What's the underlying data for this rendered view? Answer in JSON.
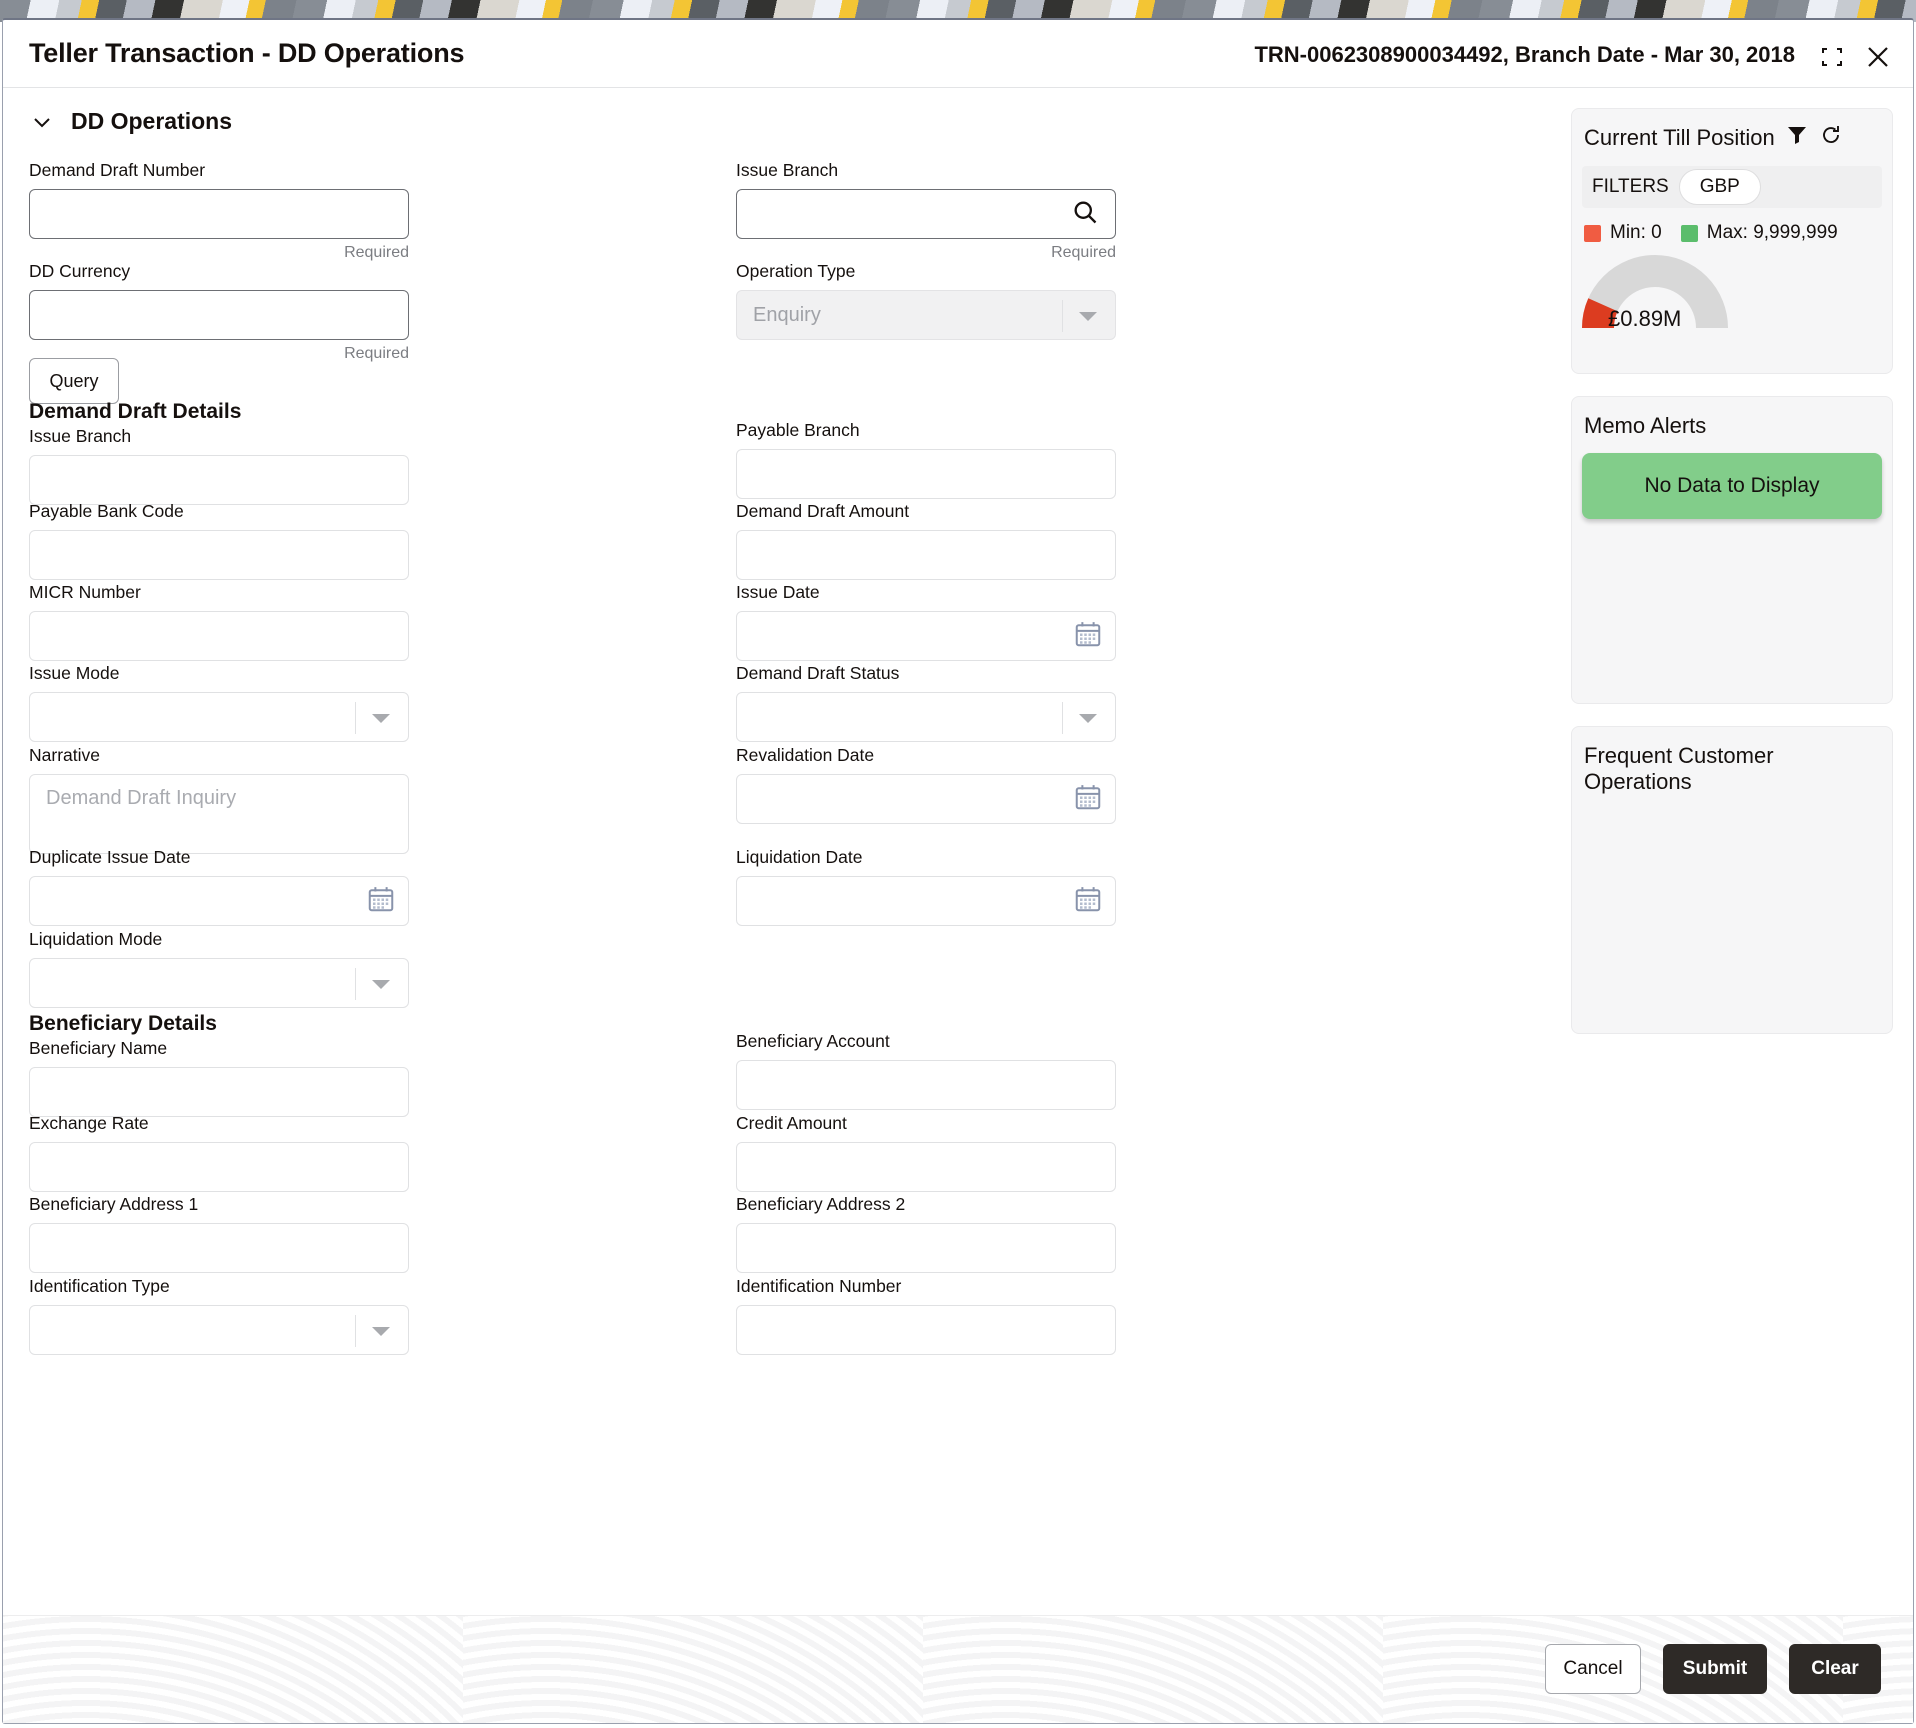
{
  "window": {
    "title": "Teller Transaction - DD Operations",
    "transaction_info": "TRN-0062308900034492, Branch Date - Mar 30, 2018",
    "collapse_icon": "collapse-icon",
    "close_icon": "close-icon"
  },
  "section": {
    "chevron_icon": "chevron-down-icon",
    "title": "DD Operations"
  },
  "form": {
    "left": [
      {
        "label": "Demand Draft Number",
        "type": "text",
        "value": "",
        "hint": "Required",
        "editable": true
      },
      {
        "label": "DD Currency",
        "type": "text",
        "value": "",
        "hint": "Required",
        "editable": true
      },
      {
        "label": "Query",
        "type": "button"
      },
      {
        "label": "Demand Draft Details",
        "type": "group"
      },
      {
        "label": "Issue Branch",
        "type": "text",
        "value": "",
        "editable": false
      },
      {
        "label": "Payable Bank Code",
        "type": "text",
        "value": "",
        "editable": false
      },
      {
        "label": "MICR Number",
        "type": "text",
        "value": "",
        "editable": false
      },
      {
        "label": "Issue Mode",
        "type": "select",
        "value": "",
        "editable": false
      },
      {
        "label": "Narrative",
        "type": "textarea",
        "value": "",
        "placeholder": "Demand Draft Inquiry"
      },
      {
        "label": "Duplicate Issue Date",
        "type": "date",
        "value": ""
      },
      {
        "label": "Liquidation Mode",
        "type": "select",
        "value": ""
      },
      {
        "label": "Beneficiary Details",
        "type": "group"
      },
      {
        "label": "Beneficiary Name",
        "type": "text",
        "value": ""
      },
      {
        "label": "Exchange Rate",
        "type": "text",
        "value": ""
      },
      {
        "label": "Beneficiary Address 1",
        "type": "text",
        "value": ""
      },
      {
        "label": "Identification Type",
        "type": "select",
        "value": ""
      }
    ],
    "right": [
      {
        "label": "Issue Branch",
        "type": "search",
        "value": "",
        "hint": "Required",
        "editable": true
      },
      {
        "label": "Operation Type",
        "type": "select",
        "value": "Enquiry",
        "filled": true
      },
      {
        "label": "Payable Branch",
        "type": "text",
        "value": ""
      },
      {
        "label": "Demand Draft Amount",
        "type": "text",
        "value": ""
      },
      {
        "label": "Issue Date",
        "type": "date",
        "value": ""
      },
      {
        "label": "Demand Draft Status",
        "type": "select",
        "value": ""
      },
      {
        "label": "Revalidation Date",
        "type": "date",
        "value": ""
      },
      {
        "label": "Liquidation Date",
        "type": "date",
        "value": ""
      },
      {
        "label": "Beneficiary Account",
        "type": "text",
        "value": ""
      },
      {
        "label": "Credit Amount",
        "type": "text",
        "value": ""
      },
      {
        "label": "Beneficiary Address 2",
        "type": "text",
        "value": ""
      },
      {
        "label": "Identification Number",
        "type": "text",
        "value": ""
      }
    ]
  },
  "till": {
    "title": "Current Till Position",
    "filter_icon": "filter-icon",
    "refresh_icon": "refresh-icon",
    "filters_label": "FILTERS",
    "currency_pill": "GBP",
    "min_label": "Min: 0",
    "max_label": "Max: 9,999,999",
    "min_color": "#f05c42",
    "max_color": "#5bbd6c",
    "gauge_value_label": "£0.89M",
    "gauge_percent": 9,
    "gauge_track_color": "#d8d8d8",
    "gauge_fill_color": "#dc3c20"
  },
  "memo": {
    "title": "Memo Alerts",
    "empty_text": "No Data to Display",
    "empty_bg": "#82cd8a"
  },
  "frequent": {
    "title": "Frequent Customer Operations"
  },
  "footer": {
    "cancel_label": "Cancel",
    "submit_label": "Submit",
    "clear_label": "Clear"
  }
}
